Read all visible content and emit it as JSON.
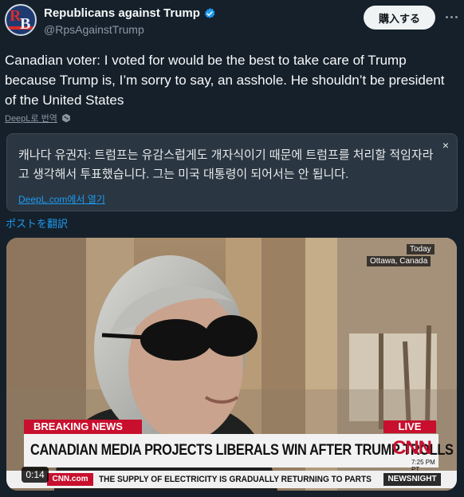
{
  "author": {
    "display_name": "Republicans against Trump",
    "handle": "@RpsAgainstTrump",
    "avatar_letters": [
      "R",
      "B"
    ]
  },
  "header": {
    "subscribe_label": "購入する"
  },
  "tweet": {
    "text": "Canadian voter: I voted for would be the best to take care of Trump because Trump is, I’m sorry to say, an asshole. He shouldn’t be president of the United States"
  },
  "deepl": {
    "link_label": "DeepL로 번역",
    "translation": "캐나다 유권자: 트럼프는 유감스럽게도 개자식이기 때문에 트럼프를 처리할 적임자라고 생각해서 투표했습니다. 그는 미국 대통령이 되어서는 안 됩니다.",
    "open_label": "DeepL.com에서 열기",
    "close_symbol": "×"
  },
  "translate_post_label": "ポストを翻訳",
  "video": {
    "location_day": "Today",
    "location_place": "Ottawa, Canada",
    "breaking": "BREAKING NEWS",
    "live": "LIVE",
    "headline": "CANADIAN MEDIA PROJECTS LIBERALS WIN AFTER TRUMP TROLLS",
    "network_logo": "CNN",
    "timestamp": "7:25 PM PT",
    "cnn_com": "CNN.com",
    "ticker": "THE SUPPLY OF ELECTRICITY IS GRADUALLY RETURNING TO PARTS",
    "show": "NEWSNIGHT",
    "duration": "0:14"
  },
  "colors": {
    "background": "#15202b",
    "link": "#1d9bf0",
    "cnn_red": "#c8102e",
    "verified": "#1d9bf0"
  },
  "icons": [
    "verified-badge-icon",
    "more-icon",
    "deepl-icon",
    "close-icon"
  ]
}
